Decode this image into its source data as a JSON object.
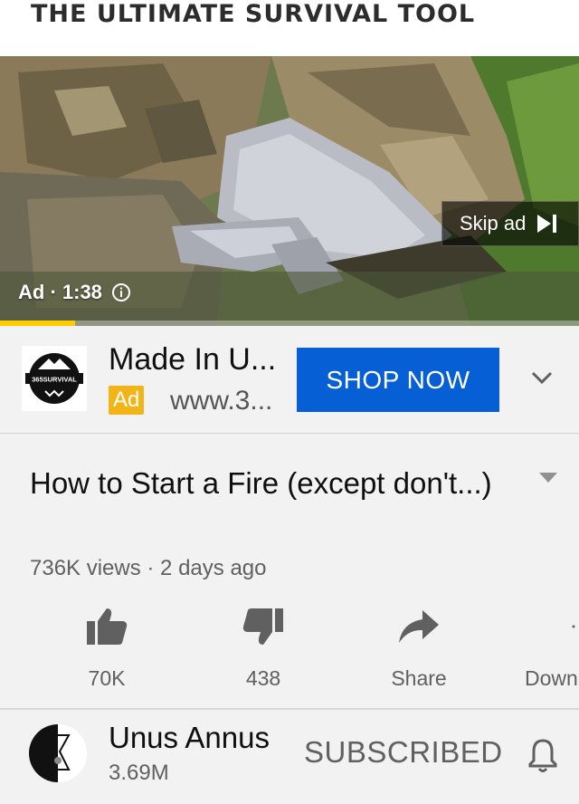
{
  "player": {
    "ad_banner_text": "THE ULTIMATE SURVIVAL TOOL",
    "skip_label": "Skip ad",
    "ad_time_label": "Ad · 1:38",
    "ad_progress": 0.13
  },
  "ad_card": {
    "advertiser_logo_text": "365SURVIVAL",
    "title": "Made In U...",
    "badge": "Ad",
    "url": "www.3...",
    "cta_label": "SHOP NOW"
  },
  "video": {
    "title": "How to Start a Fire (except don't...)",
    "meta": "736K views · 2 days ago"
  },
  "actions": {
    "like_label": "70K",
    "dislike_label": "438",
    "share_label": "Share",
    "download_label": "Down"
  },
  "channel": {
    "name": "Unus Annus",
    "subscribers": "3.69M",
    "subscribe_state": "SUBSCRIBED"
  },
  "colors": {
    "accent_blue": "#065fd4",
    "ad_badge": "#f2b518",
    "ad_progress": "#ffcc00"
  },
  "icons": [
    "info-icon",
    "skip-next-icon",
    "chevron-down-icon",
    "thumb-up-icon",
    "thumb-down-icon",
    "share-arrow-icon",
    "download-icon",
    "bell-icon"
  ]
}
